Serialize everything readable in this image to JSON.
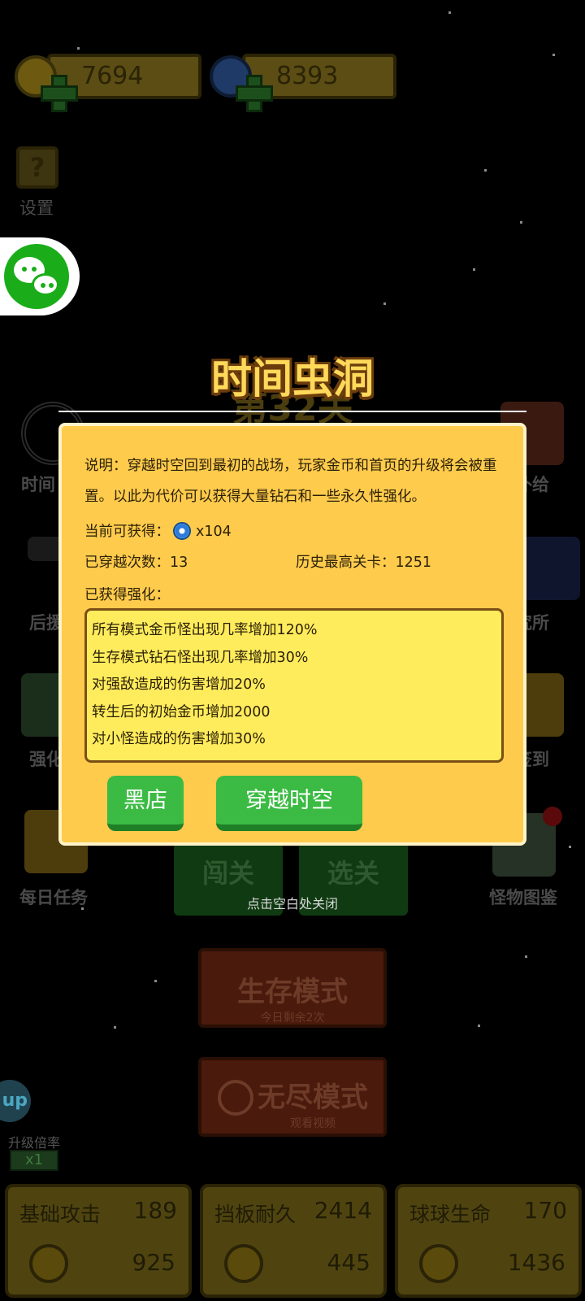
{
  "resources": {
    "coins": "7694",
    "gems": "8393"
  },
  "side": {
    "settings": "设置",
    "left_labels": [
      "时间",
      "后援",
      "强化",
      "每日任务"
    ],
    "right_labels": [
      "补给",
      "究所",
      "签到",
      "怪物图鉴"
    ]
  },
  "bg_level": "第32关",
  "buttons_bg": {
    "challenge": "闯关",
    "select": "选关",
    "survival": "生存模式",
    "survival_sub": "今日剩余2次",
    "endless": "无尽模式",
    "endless_sub": "观看视频"
  },
  "multiplier": {
    "label": "升级倍率",
    "value": "x1",
    "up": "up"
  },
  "stats": [
    {
      "name": "基础攻击",
      "value": "189",
      "cost": "925"
    },
    {
      "name": "挡板耐久",
      "value": "2414",
      "cost": "445"
    },
    {
      "name": "球球生命",
      "value": "170",
      "cost": "1436"
    }
  ],
  "popup": {
    "title": "时间虫洞",
    "description": "说明：穿越时空回到最初的战场，玩家金币和首页的升级将会被重置。以此为代价可以获得大量钻石和一些永久性强化。",
    "gain_label": "当前可获得：",
    "gain_value": "x104",
    "count_label": "已穿越次数：13",
    "best_label": "历史最高关卡：1251",
    "buffs_label": "已获得强化：",
    "buffs": [
      "所有模式金币怪出现几率增加120%",
      "生存模式钻石怪出现几率增加30%",
      "对强敌造成的伤害增加20%",
      "转生后的初始金币增加2000",
      "对小怪造成的伤害增加30%"
    ],
    "shop_button": "黑店",
    "travel_button": "穿越时空",
    "close_hint": "点击空白处关闭"
  },
  "colors": {
    "dialog_bg": "#fecb4c",
    "buff_bg": "#ffec5c",
    "button_green": "#3bbb43",
    "title_yellow": "#ffd95a"
  }
}
